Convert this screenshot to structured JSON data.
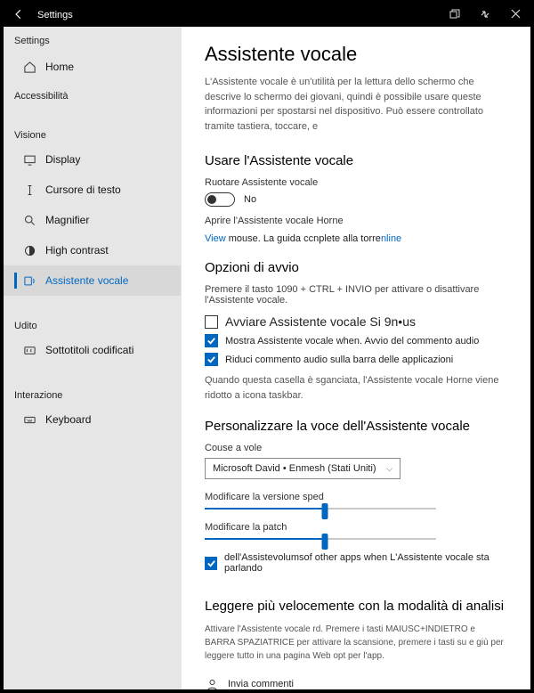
{
  "titlebar": {
    "title": "Settings"
  },
  "sidebar": {
    "app_title": "Settings",
    "home": "Home",
    "group_accessibility": "Accessibilità",
    "group_vision": "Visione",
    "group_hearing": "Udito",
    "group_interaction": "Interazione",
    "items": {
      "display": "Display",
      "text_cursor": "Cursore di testo",
      "magnifier": "Magnifier",
      "high_contrast": "High contrast",
      "narrator": "Assistente vocale",
      "subtitles": "Sottotitoli codificati",
      "keyboard": "Keyboard"
    }
  },
  "main": {
    "heading": "Assistente vocale",
    "intro": "L'Assistente vocale è un'utilità per la lettura dello schermo che descrive lo schermo dei giovani, quindi è possibile usare queste informazioni per spostarsi nel dispositivo. Può essere controllato tramite tastiera, toccare, e",
    "use_heading": "Usare l'Assistente vocale",
    "toggle_label": "Ruotare Assistente vocale",
    "toggle_state": "No",
    "open_home": "Aprire l'Assistente vocale Horne",
    "view_word": "View",
    "view_mid": " mouse. La guida ccnplete alla torre",
    "view_link2": "nline",
    "startup_heading": "Opzioni di avvio",
    "startup_hint": "Premere il tasto 1090 + CTRL + INVIO per attivare o disattivare l'Assistente vocale.",
    "start_title_check": "Avviare Assistente vocale Si 9n•us",
    "chk_show": "Mostra Assistente vocale when. Avvio del commento audio",
    "chk_minimize": "Riduci commento audio sulla barra delle applicazioni",
    "minimize_para": "Quando questa casella è sganciata, l'Assistente vocale Horne viene ridotto a icona taskbar.",
    "voice_heading": "Personalizzare la voce dell'Assistente vocale",
    "voice_label": "Couse a vole",
    "voice_value": "Microsoft David • Enmesh (Stati Uniti)",
    "speed_label": "Modificare la versione sped",
    "pitch_label": "Modificare la patch",
    "lower_volume_a": "dell'Assistevolumsof other apps when ",
    "lower_volume_b": "L'Assistente vocale sta parlando",
    "scan_heading": "Leggere più velocemente con la modalità di analisi",
    "scan_para": "Attivare l'Assistente vocale rd. Premere i tasti MAIUSC+INDIETRO e BARRA SPAZIATRICE per attivare la scansione, premere i tasti su e giù per leggere tutto in una pagina Web opt per l'app.",
    "feedback": "Invia commenti"
  },
  "sliders": {
    "speed": 52,
    "pitch": 52
  }
}
